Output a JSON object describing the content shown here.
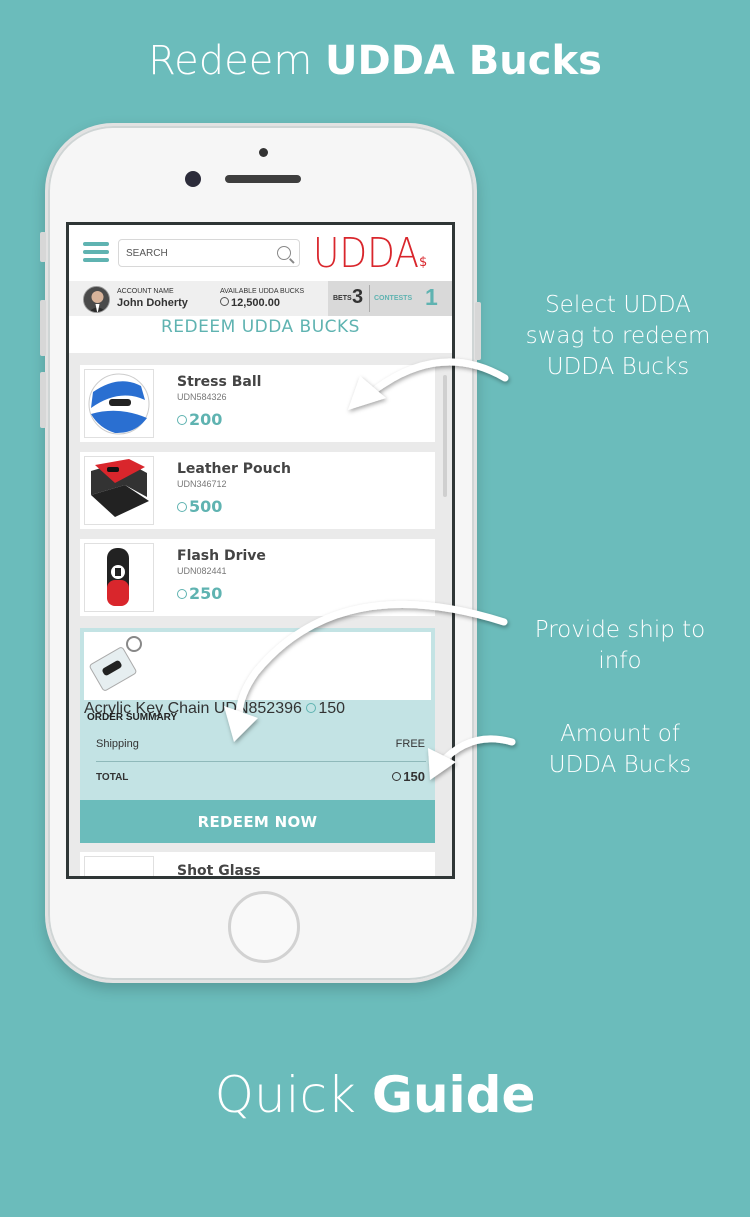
{
  "header": {
    "title_light": "Redeem",
    "title_bold": "UDDA Bucks"
  },
  "footer": {
    "title_light": "Quick",
    "title_bold": "Guide"
  },
  "app": {
    "search_placeholder": "SEARCH",
    "logo_text": "UDDA",
    "account": {
      "name_label": "ACCOUNT NAME",
      "name": "John Doherty",
      "bucks_label": "AVAILABLE UDDA BUCKS",
      "bucks": "12,500.00",
      "bets_label": "BETS",
      "bets": "3",
      "contests_label": "CONTESTS",
      "contests": "1"
    },
    "page_heading": "REDEEM UDDA BUCKS",
    "items": [
      {
        "name": "Stress Ball",
        "sku": "UDN584326",
        "price": "200",
        "icon": "stress-ball-image"
      },
      {
        "name": "Leather Pouch",
        "sku": "UDN346712",
        "price": "500",
        "icon": "leather-pouch-image"
      },
      {
        "name": "Flash Drive",
        "sku": "UDN082441",
        "price": "250",
        "icon": "flash-drive-image"
      },
      {
        "name": "Acrylic Key Chain",
        "sku": "UDN852396",
        "price": "150",
        "icon": "key-chain-image"
      },
      {
        "name": "Shot Glass",
        "icon": "shot-glass-image"
      }
    ],
    "order_summary": {
      "title": "ORDER SUMMARY",
      "shipping_label": "Shipping",
      "shipping_value": "FREE",
      "total_label": "TOTAL",
      "total_value": "150"
    },
    "redeem_button": "REDEEM NOW"
  },
  "annotations": {
    "select": [
      "Select UDDA",
      "swag to redeem",
      "UDDA Bucks"
    ],
    "ship": [
      "Provide ship to",
      "info"
    ],
    "amount": [
      "Amount of",
      "UDDA Bucks"
    ]
  },
  "colors": {
    "background": "#6bbcbb",
    "accent": "#5fb3b1",
    "logo_red": "#d9262c"
  }
}
